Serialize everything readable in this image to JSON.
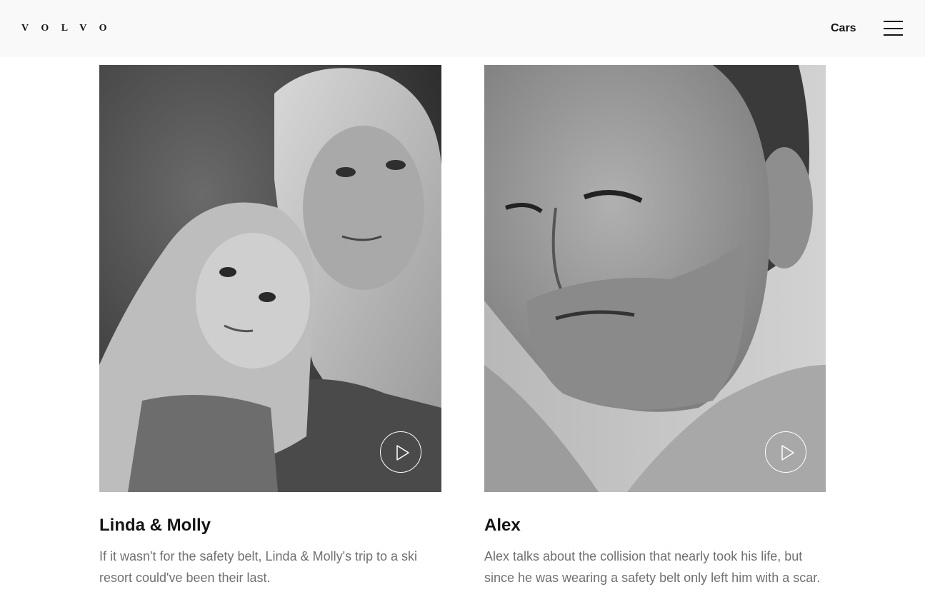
{
  "header": {
    "logo": "VOLVO",
    "nav_cars": "Cars",
    "menu_icon": "hamburger-menu-icon"
  },
  "cards": [
    {
      "title": "Linda & Molly",
      "description": "If it wasn't for the safety belt, Linda & Molly's trip to a ski resort could've been their last.",
      "play_icon": "play-icon"
    },
    {
      "title": "Alex",
      "description": "Alex talks about the collision that nearly took his life, but since he was wearing a safety belt only left him with a scar.",
      "play_icon": "play-icon"
    }
  ],
  "colors": {
    "header_bg": "#f9f9f9",
    "text_primary": "#141414",
    "text_secondary": "#707070"
  }
}
